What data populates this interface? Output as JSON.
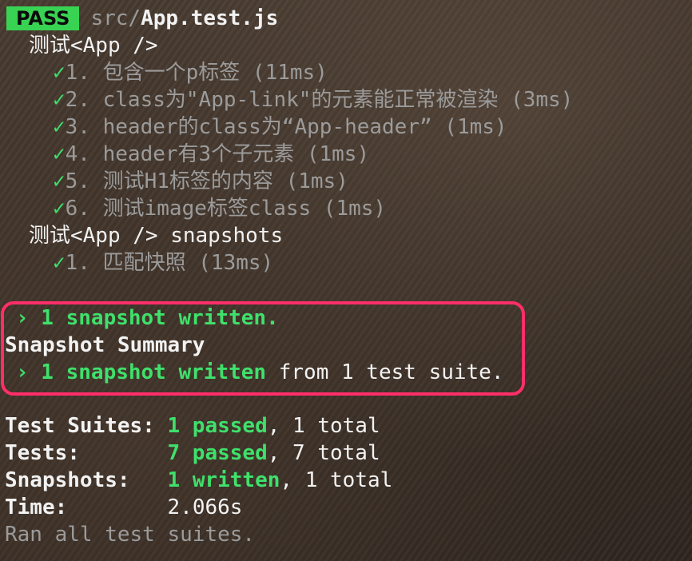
{
  "header": {
    "badge": "PASS",
    "path_dir": "src/",
    "path_file": "App.test.js"
  },
  "suites": [
    {
      "title": "测试<App />",
      "tests": [
        {
          "check": "✓",
          "label": "1. 包含一个p标签 (11ms)"
        },
        {
          "check": "✓",
          "label": "2. class为\"App-link\"的元素能正常被渲染 (3ms)"
        },
        {
          "check": "✓",
          "label": "3. header的class为“App-header” (1ms)"
        },
        {
          "check": "✓",
          "label": "4. header有3个子元素 (1ms)"
        },
        {
          "check": "✓",
          "label": "5. 测试H1标签的内容 (1ms)"
        },
        {
          "check": "✓",
          "label": "6. 测试image标签class (1ms)"
        }
      ]
    },
    {
      "title": "测试<App /> snapshots",
      "tests": [
        {
          "check": "✓",
          "label": "1. 匹配快照 (13ms)"
        }
      ]
    }
  ],
  "snapshot_box": {
    "line1": "› 1 snapshot written.",
    "summary_title": "Snapshot Summary",
    "line3_green": "› 1 snapshot written",
    "line3_rest": " from 1 test suite."
  },
  "summary": {
    "suites_label": "Test Suites:",
    "suites_passed": "1 passed",
    "suites_total": ", 1 total",
    "tests_label": "Tests:",
    "tests_passed": "7 passed",
    "tests_total": ", 7 total",
    "snapshots_label": "Snapshots:",
    "snapshots_written": "1 written",
    "snapshots_total": ", 1 total",
    "time_label": "Time:",
    "time_value": "2.066s",
    "ran_all": "Ran all test suites."
  },
  "colors": {
    "pass_badge": "#39d353",
    "green_text": "#3fe06b",
    "highlight_border": "#ff2e6a",
    "dim_text": "#9b9b9b"
  }
}
